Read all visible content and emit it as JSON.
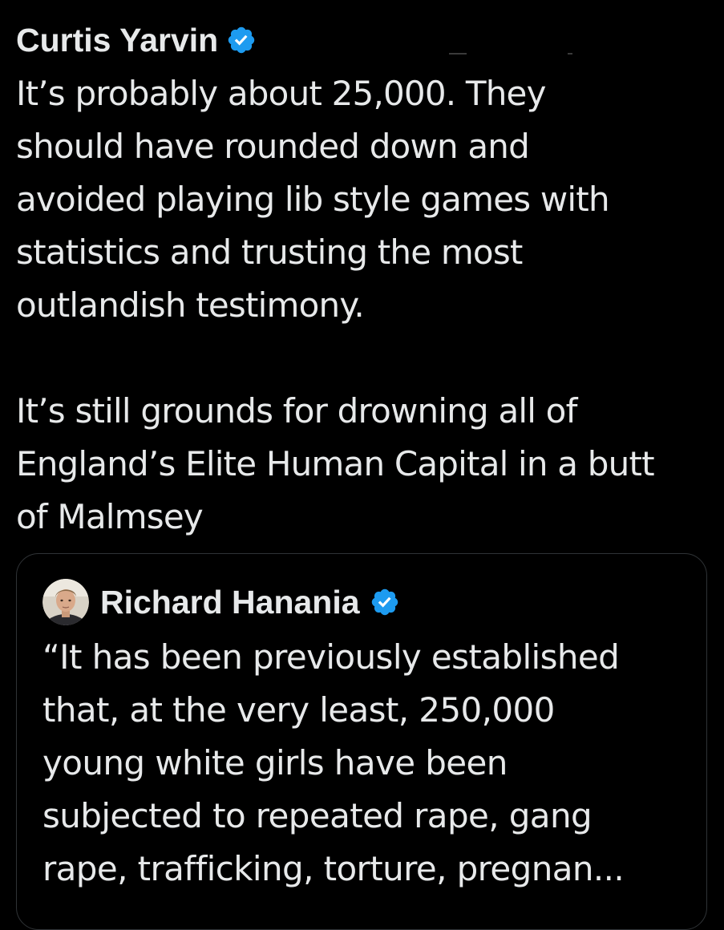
{
  "colors": {
    "background": "#000000",
    "text": "#e7e9ea",
    "verified_badge": "#1d9bf0",
    "card_border": "#2f3336"
  },
  "tweet": {
    "author_name": "Curtis Yarvin",
    "verified_icon": "verified-badge-icon",
    "body_lines": [
      "It’s probably about 25,000. They",
      "should have rounded down and",
      "avoided playing lib style games with",
      "statistics and trusting the most",
      "outlandish testimony."
    ],
    "body_lines_2": [
      "It’s still grounds for drowning all of",
      "England’s Elite Human Capital in a butt",
      "of Malmsey"
    ]
  },
  "quoted_tweet": {
    "author_name": "Richard Hanania",
    "verified_icon": "verified-badge-icon",
    "avatar_icon": "profile-photo",
    "body_lines": [
      "“It has been previously established",
      "that, at the very least, 250,000",
      "young white girls have been",
      "subjected to repeated rape, gang",
      "rape, trafficking, torture, pregnan..."
    ]
  }
}
